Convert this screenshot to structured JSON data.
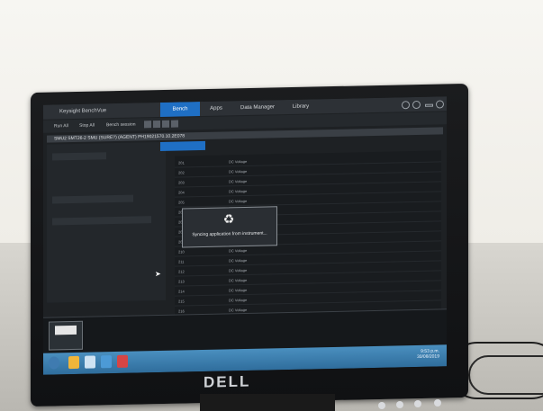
{
  "app": {
    "title": "Keysight BenchVue",
    "tabs": [
      "Bench",
      "Apps",
      "Data Manager",
      "Library"
    ],
    "active_tab": "Bench"
  },
  "toolbar": {
    "items": [
      "Run All",
      "Stop All",
      "Bench session"
    ]
  },
  "instrument": {
    "title": "SMU2 SMT26-2 SMU (SURE?) (AGENT) PH19021570.10.2E078"
  },
  "dialog": {
    "message": "Syncing application from instrument..."
  },
  "table": {
    "headers": [
      "Channel",
      "Type",
      "Mode",
      "Protection"
    ],
    "rows": [
      {
        "ch": "201",
        "mode": "DC Voltage"
      },
      {
        "ch": "202",
        "mode": "DC Voltage"
      },
      {
        "ch": "203",
        "mode": "DC Voltage"
      },
      {
        "ch": "204",
        "mode": "DC Voltage"
      },
      {
        "ch": "205",
        "mode": "DC Voltage"
      },
      {
        "ch": "206",
        "mode": "DC Voltage"
      },
      {
        "ch": "207",
        "mode": "DC Voltage"
      },
      {
        "ch": "208",
        "mode": "DC Voltage"
      },
      {
        "ch": "209",
        "mode": "DC Voltage"
      },
      {
        "ch": "210",
        "mode": "DC Voltage"
      },
      {
        "ch": "211",
        "mode": "DC Voltage"
      },
      {
        "ch": "212",
        "mode": "DC Voltage"
      },
      {
        "ch": "213",
        "mode": "DC Voltage"
      },
      {
        "ch": "214",
        "mode": "DC Voltage"
      },
      {
        "ch": "215",
        "mode": "DC Voltage"
      },
      {
        "ch": "216",
        "mode": "DC Voltage"
      }
    ]
  },
  "taskbar": {
    "time": "9:53 p.m.",
    "date": "30/08/2019"
  },
  "monitor": {
    "brand": "DELL"
  },
  "colors": {
    "accent": "#1f6fc4",
    "bezel": "#111214"
  }
}
